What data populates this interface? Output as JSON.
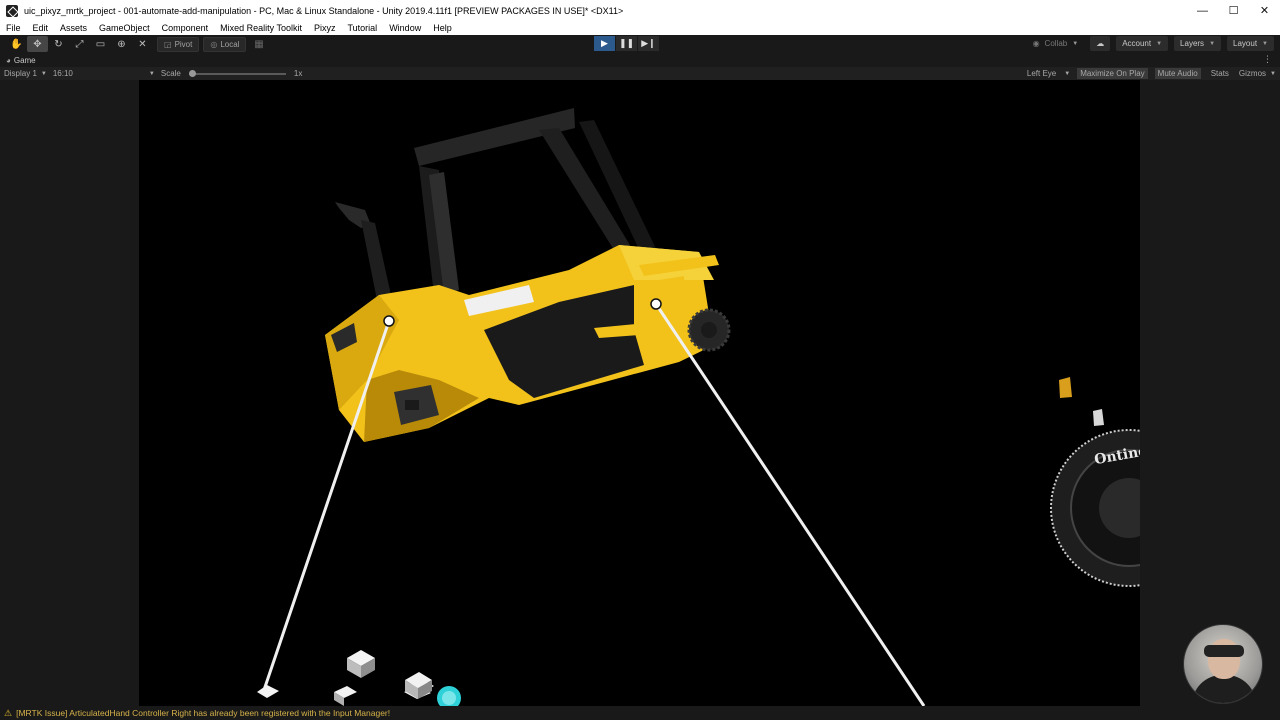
{
  "window": {
    "title": "uic_pixyz_mrtk_project - 001-automate-add-manipulation - PC, Mac & Linux Standalone - Unity 2019.4.11f1 [PREVIEW PACKAGES IN USE]* <DX11>",
    "minimize": "—",
    "maximize": "☐",
    "close": "✕"
  },
  "menu": {
    "items": [
      "File",
      "Edit",
      "Assets",
      "GameObject",
      "Component",
      "Mixed Reality Toolkit",
      "Pixyz",
      "Tutorial",
      "Window",
      "Help"
    ]
  },
  "toolbar": {
    "pivot_label": "Pivot",
    "local_label": "Local",
    "collab_label": "Collab",
    "account_label": "Account",
    "layers_label": "Layers",
    "layout_label": "Layout"
  },
  "game_tab": {
    "label": "Game"
  },
  "game_bar": {
    "display": "Display 1",
    "aspect": "16:10",
    "scale_label": "Scale",
    "scale_value": "1x",
    "scale_fraction": 0,
    "eye": "Left Eye",
    "maximize_on_play": "Maximize On Play",
    "mute_audio": "Mute Audio",
    "stats": "Stats",
    "gizmos": "Gizmos"
  },
  "scene": {
    "wheel_text": "Ontine"
  },
  "status": {
    "message": "[MRTK Issue] ArticulatedHand Controller Right has already been registered with the Input Manager!"
  },
  "colors": {
    "forklift_yellow": "#f2c21b",
    "play_blue": "#2d5a8c",
    "warning": "#e5b92d"
  }
}
